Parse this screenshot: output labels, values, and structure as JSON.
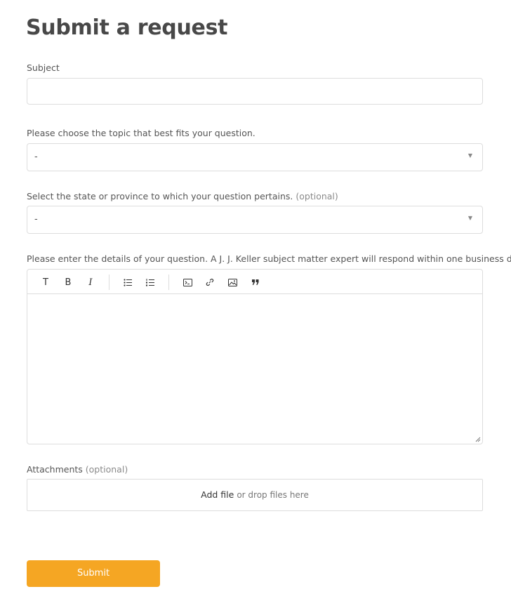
{
  "page": {
    "title": "Submit a request"
  },
  "form": {
    "subject": {
      "label": "Subject",
      "value": ""
    },
    "topic": {
      "label": "Please choose the topic that best fits your question.",
      "selected": "-"
    },
    "state": {
      "label": "Select the state or province to which your question pertains.",
      "optional": "(optional)",
      "selected": "-"
    },
    "details": {
      "label": "Please enter the details of your question. A J. J. Keller subject matter expert will respond within one business day.",
      "toolbar": {
        "text_label": "T",
        "bold_label": "B",
        "italic_label": "I",
        "icons": [
          "text-icon",
          "bold-icon",
          "italic-icon",
          "bulleted-list-icon",
          "numbered-list-icon",
          "code-block-icon",
          "link-icon",
          "image-icon",
          "quote-icon"
        ]
      },
      "value": ""
    },
    "attachments": {
      "label": "Attachments",
      "optional": "(optional)",
      "add_file": "Add file",
      "drop_text": "or drop files here"
    },
    "submit_label": "Submit"
  },
  "colors": {
    "accent": "#f5a623",
    "border": "#dddddd",
    "title": "#484848",
    "text": "#555555"
  }
}
